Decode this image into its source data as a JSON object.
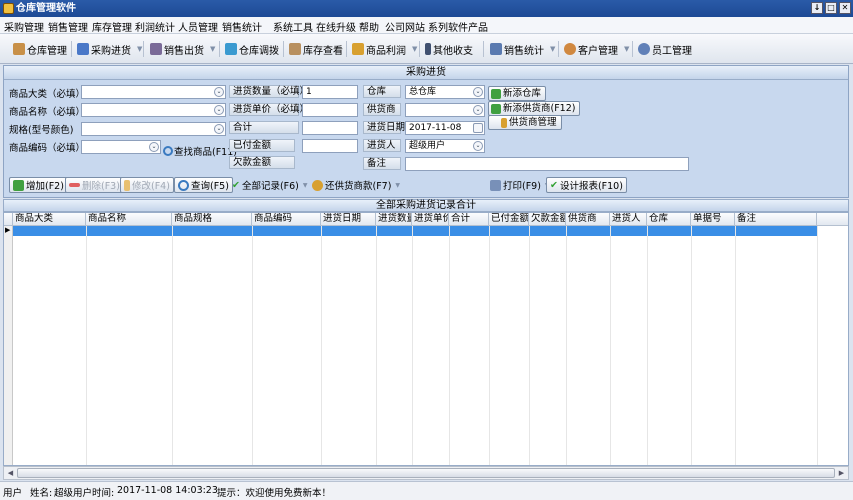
{
  "window": {
    "title": "仓库管理软件",
    "buttons": [
      "↓",
      "□",
      "✕"
    ]
  },
  "menu": [
    "采购管理",
    "销售管理",
    "库存管理",
    "利润统计",
    "人员管理",
    "销售统计",
    "系统工具",
    "在线升级",
    "帮助",
    "公司网站",
    "系列软件产品"
  ],
  "toolbar": [
    "仓库管理",
    "采购进货",
    "销售出货",
    "仓库调拨",
    "库存查看",
    "商品利润",
    "其他收支",
    "销售统计",
    "客户管理",
    "员工管理"
  ],
  "form": {
    "section_title": "采购进货",
    "category_label": "商品大类（必填）",
    "name_label": "商品名称（必填）",
    "spec_label": "规格(型号颜色)",
    "code_label": "商品编码（必填）",
    "qty_label": "进货数量（必填）",
    "price_label": "进货单价（必填）",
    "total_label": "合计",
    "paid_label": "已付金额",
    "owed_label": "欠款金额",
    "qty_value": "1",
    "warehouse_label": "仓库",
    "warehouse_value": "总仓库",
    "supplier_label": "供货商",
    "date_label": "进货日期",
    "date_value": "2017-11-08",
    "buyer_label": "进货人",
    "buyer_value": "超级用户",
    "note_label": "备注",
    "find_product": "查找商品(F11)",
    "new_warehouse": "新添仓库",
    "new_supplier": "新添供货商(F12)",
    "supplier_mgmt": "供货商管理"
  },
  "actions": {
    "add": "增加(F2)",
    "delete": "删除(F3)",
    "edit": "修改(F4)",
    "query": "查询(F5)",
    "all_records": "全部记录(F6)",
    "repay": "还供货商款(F7)",
    "print": "打印(F9)",
    "design_report": "设计报表(F10)"
  },
  "grid": {
    "title": "全部采购进货记录合计",
    "columns": [
      "商品大类",
      "商品名称",
      "商品规格",
      "商品编码",
      "进货日期",
      "进货数量",
      "进货单价",
      "合计",
      "已付金额",
      "欠款金额",
      "供货商",
      "进货人",
      "仓库",
      "单据号",
      "备注"
    ]
  },
  "status": {
    "user_label": "用户",
    "name_label": "姓名:",
    "user_value": "超级用户",
    "time_label": "时间:",
    "time_value": "2017-11-08 14:03:23",
    "tip": "提示：欢迎使用免费新本！"
  },
  "colors": {
    "title_bar": "#1d4a95",
    "selection": "#3a8ee6",
    "panel": "#c8d8ee"
  }
}
